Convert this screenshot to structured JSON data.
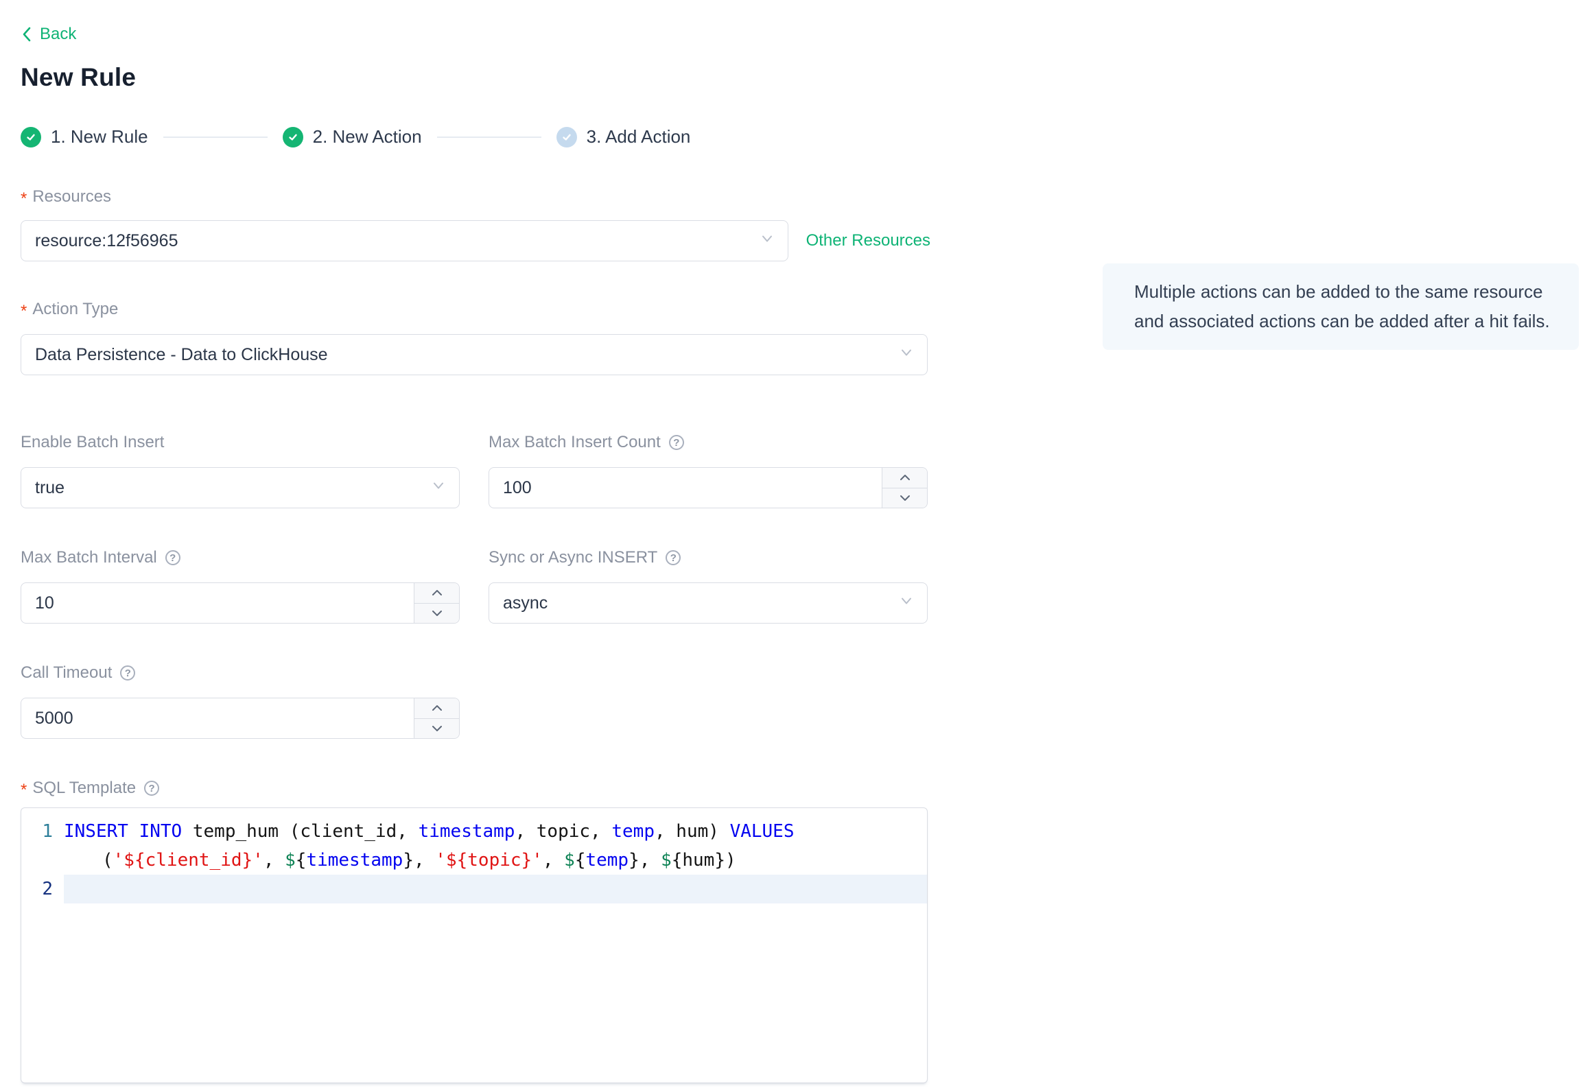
{
  "page": {
    "back_label": "Back",
    "title": "New Rule",
    "required_marker": "*",
    "help_glyph": "?"
  },
  "colors": {
    "accent_green": "#0eb375",
    "step_done": "#15b573",
    "step_pending": "#c5daee",
    "required_red": "#ed4014",
    "info_bg": "#f3f8fc"
  },
  "steps": [
    {
      "label": "1. New Rule",
      "state": "done"
    },
    {
      "label": "2. New Action",
      "state": "done"
    },
    {
      "label": "3. Add Action",
      "state": "pending"
    }
  ],
  "form": {
    "resources": {
      "label": "Resources",
      "value": "resource:12f56965",
      "other_link": "Other Resources"
    },
    "action_type": {
      "label": "Action Type",
      "value": "Data Persistence - Data to ClickHouse"
    },
    "enable_batch": {
      "label": "Enable Batch Insert",
      "value": "true"
    },
    "max_batch_count": {
      "label": "Max Batch Insert Count",
      "value": "100"
    },
    "max_batch_interval": {
      "label": "Max Batch Interval",
      "value": "10"
    },
    "sync_async": {
      "label": "Sync or Async INSERT",
      "value": "async"
    },
    "call_timeout": {
      "label": "Call Timeout",
      "value": "5000"
    },
    "sql_template": {
      "label": "SQL Template"
    }
  },
  "info_panel": {
    "text": "Multiple actions can be added to the same resource and associated actions can be added after a hit fails."
  },
  "editor": {
    "rows": [
      {
        "num": "1",
        "num_class": "ed-num1",
        "indent": false,
        "active": false,
        "tokens": [
          {
            "c": "kw",
            "t": "INSERT"
          },
          {
            "c": "pl",
            "t": " "
          },
          {
            "c": "kw",
            "t": "INTO"
          },
          {
            "c": "pl",
            "t": " temp_hum (client_id, "
          },
          {
            "c": "kw",
            "t": "timestamp"
          },
          {
            "c": "pl",
            "t": ", topic, "
          },
          {
            "c": "kw",
            "t": "temp"
          },
          {
            "c": "pl",
            "t": ", hum) "
          },
          {
            "c": "kw",
            "t": "VALUES"
          }
        ]
      },
      {
        "num": "",
        "num_class": "",
        "indent": true,
        "active": false,
        "tokens": [
          {
            "c": "pl",
            "t": "("
          },
          {
            "c": "str",
            "t": "'${client_id}'"
          },
          {
            "c": "pl",
            "t": ", "
          },
          {
            "c": "dollar",
            "t": "$"
          },
          {
            "c": "pl",
            "t": "{"
          },
          {
            "c": "kw",
            "t": "timestamp"
          },
          {
            "c": "pl",
            "t": "}, "
          },
          {
            "c": "str",
            "t": "'${topic}'"
          },
          {
            "c": "pl",
            "t": ", "
          },
          {
            "c": "dollar",
            "t": "$"
          },
          {
            "c": "pl",
            "t": "{"
          },
          {
            "c": "kw",
            "t": "temp"
          },
          {
            "c": "pl",
            "t": "}, "
          },
          {
            "c": "dollar",
            "t": "$"
          },
          {
            "c": "pl",
            "t": "{hum})"
          }
        ]
      },
      {
        "num": "2",
        "num_class": "ed-num2",
        "indent": false,
        "active": true,
        "tokens": []
      }
    ]
  }
}
